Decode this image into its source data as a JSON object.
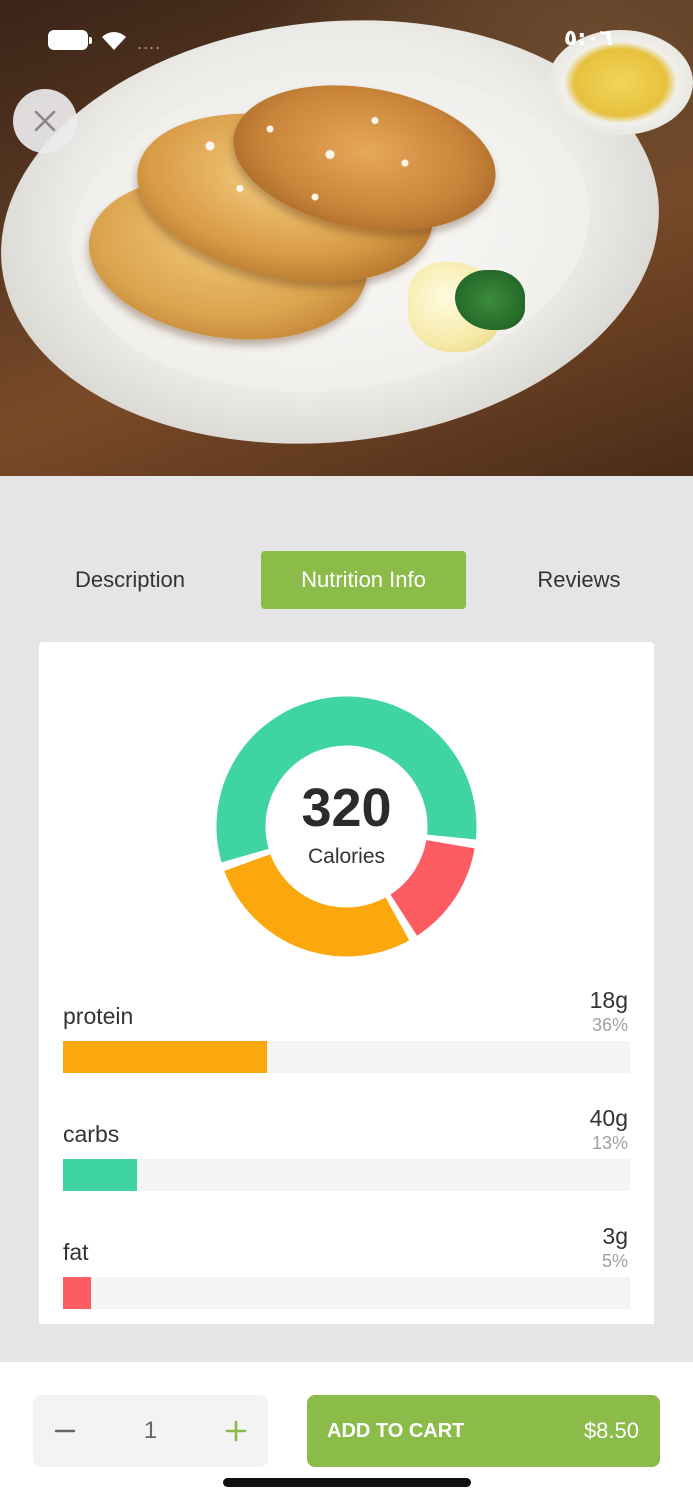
{
  "status_bar": {
    "time": "٥:٠٦",
    "signal": "....",
    "battery_icon": "battery-icon",
    "wifi_icon": "wifi-icon"
  },
  "hero": {
    "image": "pancakes-plate-photo"
  },
  "close_button": {
    "icon": "close-icon"
  },
  "tabs": [
    {
      "label": "Description",
      "active": false
    },
    {
      "label": "Nutrition Info",
      "active": true
    },
    {
      "label": "Reviews",
      "active": false
    }
  ],
  "nutrition": {
    "calories_value": "320",
    "calories_label": "Calories",
    "chart_data": {
      "type": "pie",
      "title": "",
      "center_value": 320,
      "center_label": "Calories",
      "slices": [
        {
          "name": "carbs",
          "value": 4,
          "color": "#3fd4a2"
        },
        {
          "name": "fat",
          "value": 1,
          "color": "#fd5c63"
        },
        {
          "name": "protein",
          "value": 2,
          "color": "#fda70e"
        }
      ]
    },
    "items": [
      {
        "name": "protein",
        "amount": "18g",
        "percent": "36%",
        "fraction": 0.36,
        "color": "#fda70e"
      },
      {
        "name": "carbs",
        "amount": "40g",
        "percent": "13%",
        "fraction": 0.13,
        "color": "#3fd4a2"
      },
      {
        "name": "fat",
        "amount": "3g",
        "percent": "5%",
        "fraction": 0.05,
        "color": "#fd5c63"
      }
    ]
  },
  "cart": {
    "quantity": "1",
    "minus_icon": "minus-icon",
    "plus_icon": "plus-icon",
    "add_label": "ADD TO CART",
    "price": "$8.50"
  },
  "colors": {
    "accent": "#8bbb48",
    "background": "#e5e5e5"
  }
}
